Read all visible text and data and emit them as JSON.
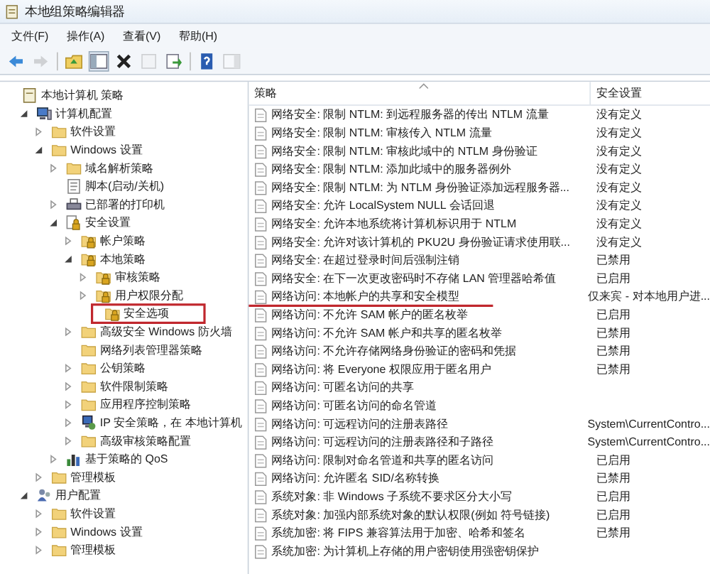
{
  "window": {
    "title": "本地组策略编辑器"
  },
  "menu": [
    "文件(F)",
    "操作(A)",
    "查看(V)",
    "帮助(H)"
  ],
  "toolbar": [
    {
      "kind": "back",
      "disabled": false
    },
    {
      "kind": "forward",
      "disabled": true
    },
    {
      "kind": "sep"
    },
    {
      "kind": "up",
      "disabled": false
    },
    {
      "kind": "tree",
      "disabled": false
    },
    {
      "kind": "delete",
      "disabled": false
    },
    {
      "kind": "properties",
      "disabled": true
    },
    {
      "kind": "export",
      "disabled": false
    },
    {
      "kind": "sep"
    },
    {
      "kind": "help",
      "disabled": false
    },
    {
      "kind": "pane",
      "disabled": true
    }
  ],
  "tree": [
    {
      "label": "本地计算机 策略",
      "kind": "policy",
      "marked": false,
      "children": [
        {
          "label": "计算机配置",
          "kind": "computer",
          "expandable": true,
          "expanded": true,
          "marked": false,
          "children": [
            {
              "label": "软件设置",
              "kind": "folder",
              "expandable": true,
              "expanded": false,
              "marked": false
            },
            {
              "label": "Windows 设置",
              "kind": "folder",
              "expandable": true,
              "expanded": true,
              "marked": false,
              "children": [
                {
                  "label": "域名解析策略",
                  "kind": "folder",
                  "expandable": true,
                  "expanded": false,
                  "marked": false
                },
                {
                  "label": "脚本(启动/关机)",
                  "kind": "script",
                  "expandable": false,
                  "expanded": false,
                  "marked": false
                },
                {
                  "label": "已部署的打印机",
                  "kind": "printer",
                  "expandable": true,
                  "expanded": false,
                  "marked": false
                },
                {
                  "label": "安全设置",
                  "kind": "lock",
                  "expandable": true,
                  "expanded": true,
                  "marked": false,
                  "children": [
                    {
                      "label": "帐户策略",
                      "kind": "lockfolder",
                      "expandable": true,
                      "expanded": false,
                      "marked": false
                    },
                    {
                      "label": "本地策略",
                      "kind": "lockfolder",
                      "expandable": true,
                      "expanded": true,
                      "marked": false,
                      "children": [
                        {
                          "label": "审核策略",
                          "kind": "lockfolder",
                          "expandable": true,
                          "expanded": false,
                          "marked": false
                        },
                        {
                          "label": "用户权限分配",
                          "kind": "lockfolder",
                          "expandable": true,
                          "expanded": false,
                          "marked": false
                        },
                        {
                          "label": "安全选项",
                          "kind": "lockfolder",
                          "expandable": false,
                          "expanded": false,
                          "marked": true
                        }
                      ]
                    },
                    {
                      "label": "高级安全 Windows 防火墙",
                      "kind": "folder",
                      "expandable": true,
                      "expanded": false,
                      "marked": false
                    },
                    {
                      "label": "网络列表管理器策略",
                      "kind": "folder",
                      "expandable": false,
                      "expanded": false,
                      "marked": false
                    },
                    {
                      "label": "公钥策略",
                      "kind": "folder",
                      "expandable": true,
                      "expanded": false,
                      "marked": false
                    },
                    {
                      "label": "软件限制策略",
                      "kind": "folder",
                      "expandable": true,
                      "expanded": false,
                      "marked": false
                    },
                    {
                      "label": "应用程序控制策略",
                      "kind": "folder",
                      "expandable": true,
                      "expanded": false,
                      "marked": false
                    },
                    {
                      "label": "IP 安全策略，在 本地计算机",
                      "kind": "network",
                      "expandable": true,
                      "expanded": false,
                      "marked": false
                    },
                    {
                      "label": "高级审核策略配置",
                      "kind": "folder",
                      "expandable": true,
                      "expanded": false,
                      "marked": false
                    }
                  ]
                },
                {
                  "label": "基于策略的 QoS",
                  "kind": "chart",
                  "expandable": true,
                  "expanded": false,
                  "marked": false
                }
              ]
            },
            {
              "label": "管理模板",
              "kind": "folder",
              "expandable": true,
              "expanded": false,
              "marked": false
            }
          ]
        },
        {
          "label": "用户配置",
          "kind": "user",
          "expandable": true,
          "expanded": true,
          "marked": false,
          "children": [
            {
              "label": "软件设置",
              "kind": "folder",
              "expandable": true,
              "expanded": false,
              "marked": false
            },
            {
              "label": "Windows 设置",
              "kind": "folder",
              "expandable": true,
              "expanded": false,
              "marked": false
            },
            {
              "label": "管理模板",
              "kind": "folder",
              "expandable": true,
              "expanded": false,
              "marked": false
            }
          ]
        }
      ]
    }
  ],
  "table": {
    "columns": [
      "策略",
      "安全设置"
    ],
    "rows": [
      {
        "policy": "网络安全: 限制 NTLM: 到远程服务器的传出 NTLM 流量",
        "setting": "没有定义",
        "underlined": false
      },
      {
        "policy": "网络安全: 限制 NTLM: 审核传入 NTLM 流量",
        "setting": "没有定义",
        "underlined": false
      },
      {
        "policy": "网络安全: 限制 NTLM: 审核此域中的 NTLM 身份验证",
        "setting": "没有定义",
        "underlined": false
      },
      {
        "policy": "网络安全: 限制 NTLM: 添加此域中的服务器例外",
        "setting": "没有定义",
        "underlined": false
      },
      {
        "policy": "网络安全: 限制 NTLM: 为 NTLM 身份验证添加远程服务器...",
        "setting": "没有定义",
        "underlined": false
      },
      {
        "policy": "网络安全: 允许 LocalSystem NULL 会话回退",
        "setting": "没有定义",
        "underlined": false
      },
      {
        "policy": "网络安全: 允许本地系统将计算机标识用于 NTLM",
        "setting": "没有定义",
        "underlined": false
      },
      {
        "policy": "网络安全: 允许对该计算机的 PKU2U 身份验证请求使用联...",
        "setting": "没有定义",
        "underlined": false
      },
      {
        "policy": "网络安全: 在超过登录时间后强制注销",
        "setting": "已禁用",
        "underlined": false
      },
      {
        "policy": "网络安全: 在下一次更改密码时不存储 LAN 管理器哈希值",
        "setting": "已启用",
        "underlined": false
      },
      {
        "policy": "网络访问: 本地帐户的共享和安全模型",
        "setting": "仅来宾 - 对本地用户进...",
        "underlined": true
      },
      {
        "policy": "网络访问: 不允许 SAM 帐户的匿名枚举",
        "setting": "已启用",
        "underlined": false
      },
      {
        "policy": "网络访问: 不允许 SAM 帐户和共享的匿名枚举",
        "setting": "已禁用",
        "underlined": false
      },
      {
        "policy": "网络访问: 不允许存储网络身份验证的密码和凭据",
        "setting": "已禁用",
        "underlined": false
      },
      {
        "policy": "网络访问: 将 Everyone 权限应用于匿名用户",
        "setting": "已禁用",
        "underlined": false
      },
      {
        "policy": "网络访问: 可匿名访问的共享",
        "underlined": false
      },
      {
        "policy": "网络访问: 可匿名访问的命名管道",
        "underlined": false
      },
      {
        "policy": "网络访问: 可远程访问的注册表路径",
        "setting": "System\\CurrentContro...",
        "underlined": false
      },
      {
        "policy": "网络访问: 可远程访问的注册表路径和子路径",
        "setting": "System\\CurrentContro...",
        "underlined": false
      },
      {
        "policy": "网络访问: 限制对命名管道和共享的匿名访问",
        "setting": "已启用",
        "underlined": false
      },
      {
        "policy": "网络访问: 允许匿名 SID/名称转换",
        "setting": "已禁用",
        "underlined": false
      },
      {
        "policy": "系统对象: 非 Windows 子系统不要求区分大小写",
        "setting": "已启用",
        "underlined": false
      },
      {
        "policy": "系统对象: 加强内部系统对象的默认权限(例如 符号链接)",
        "setting": "已启用",
        "underlined": false
      },
      {
        "policy": "系统加密: 将 FIPS 兼容算法用于加密、哈希和签名",
        "setting": "已禁用",
        "underlined": false
      },
      {
        "policy": "系统加密: 为计算机上存储的用户密钥使用强密钥保护",
        "underlined": false
      }
    ]
  }
}
